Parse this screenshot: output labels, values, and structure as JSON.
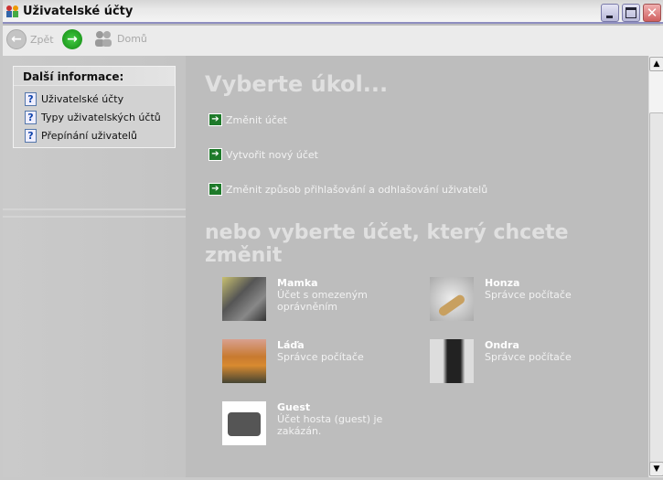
{
  "window": {
    "title": "Uživatelské účty"
  },
  "toolbar": {
    "back": "Zpět",
    "home": "Domů"
  },
  "sidebar": {
    "heading": "Další informace:",
    "items": [
      {
        "label": "Uživatelské účty"
      },
      {
        "label": "Typy uživatelských účtů"
      },
      {
        "label": "Přepínání uživatelů"
      }
    ]
  },
  "main": {
    "heading": "Vyberte úkol...",
    "tasks": [
      {
        "label": "Změnit účet"
      },
      {
        "label": "Vytvořit nový účet"
      },
      {
        "label": "Změnit způsob přihlašování a odhlašování uživatelů"
      }
    ],
    "subheading": "nebo vyberte účet, který chcete změnit",
    "accounts": [
      {
        "name": "Mamka",
        "desc": "Účet s omezeným oprávněním"
      },
      {
        "name": "Honza",
        "desc": "Správce počítače"
      },
      {
        "name": "Láďa",
        "desc": "Správce počítače"
      },
      {
        "name": "Ondra",
        "desc": "Správce počítače"
      },
      {
        "name": "Guest",
        "desc": "Účet hosta (guest) je zakázán."
      }
    ]
  }
}
